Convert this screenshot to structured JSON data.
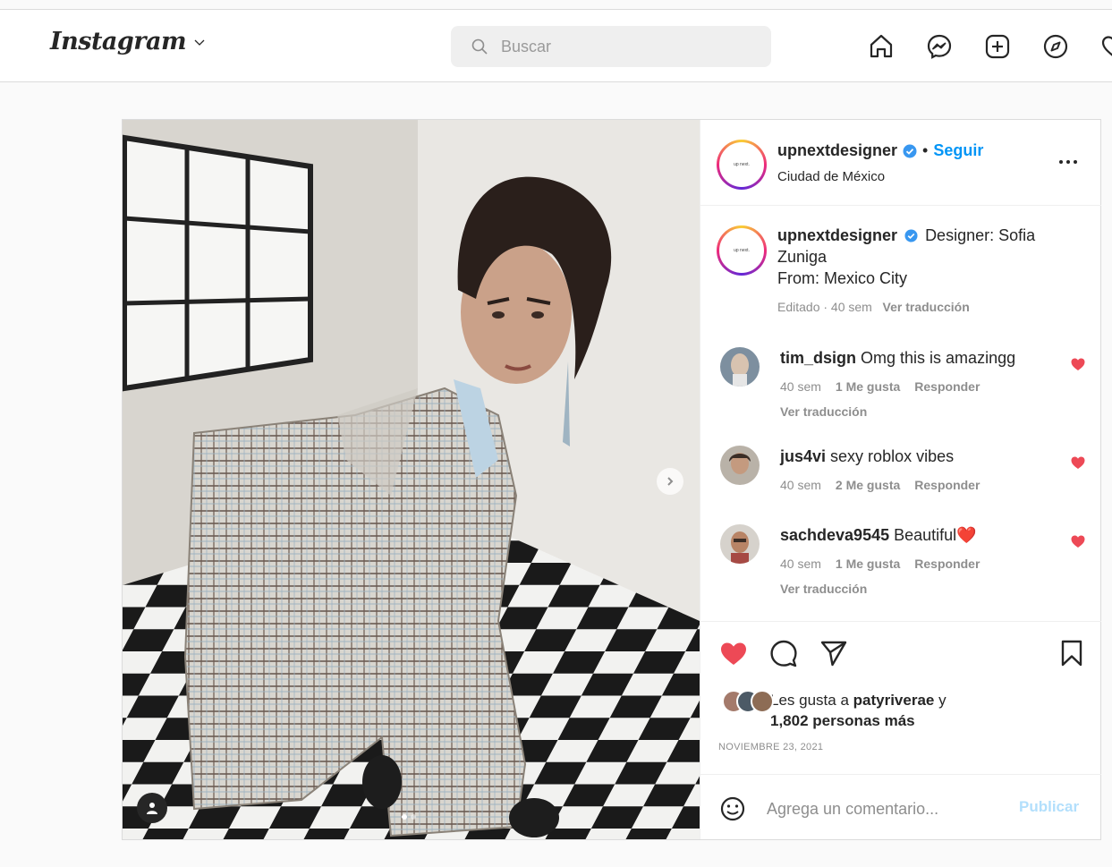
{
  "app": {
    "logo": "Instagram",
    "search": {
      "placeholder": "Buscar"
    },
    "nav_icons": [
      "home-icon",
      "messenger-icon",
      "new-post-icon",
      "explore-icon",
      "activity-heart-icon"
    ]
  },
  "post": {
    "header": {
      "username": "upnextdesigner",
      "bullet": "•",
      "follow_label": "Seguir",
      "location": "Ciudad de México",
      "avatar_brand": "up next."
    },
    "caption": {
      "username": "upnextdesigner",
      "line1": "Designer: Sofia Zuniga",
      "line2": "From: Mexico City",
      "edited": "Editado · 40 sem",
      "translate": "Ver traducción"
    },
    "comments": [
      {
        "username": "tim_dsign",
        "text": "Omg this is amazingg",
        "time": "40 sem",
        "likes": "1 Me gusta",
        "reply": "Responder",
        "translate": "Ver traducción"
      },
      {
        "username": "jus4vi",
        "text": "sexy roblox vibes",
        "time": "40 sem",
        "likes": "2 Me gusta",
        "reply": "Responder"
      },
      {
        "username": "sachdeva9545",
        "text": "Beautiful",
        "emoji": "❤️",
        "time": "40 sem",
        "likes": "1 Me gusta",
        "reply": "Responder",
        "translate": "Ver traducción"
      }
    ],
    "likes": {
      "prefix": "Les gusta a",
      "user": "patyriverae",
      "conj": "y",
      "others": "1,802 personas más"
    },
    "date": "NOVIEMBRE 23, 2021",
    "add_comment": {
      "placeholder": "Agrega un comentario...",
      "publish_label": "Publicar"
    },
    "carousel": {
      "current": 1,
      "total": 2
    },
    "colors": {
      "accent": "#0095f6",
      "like": "#ed4956",
      "publish_disabled": "#b2dffc"
    }
  }
}
